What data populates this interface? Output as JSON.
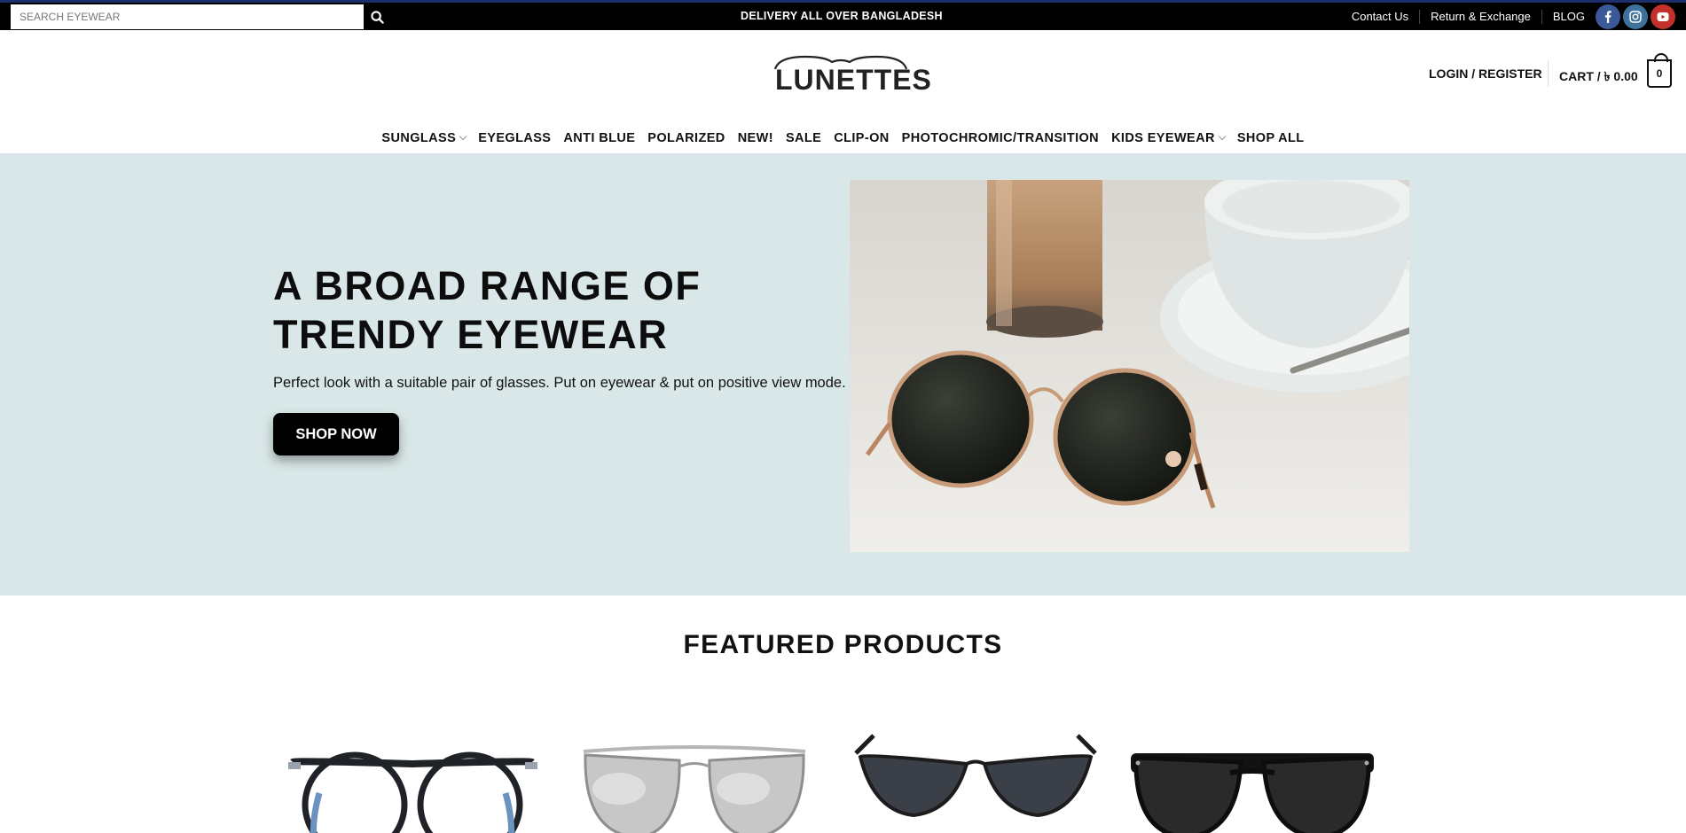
{
  "topbar": {
    "search_placeholder": "SEARCH EYEWEAR",
    "announcement": "DELIVERY ALL OVER BANGLADESH",
    "links": [
      "Contact Us",
      "Return & Exchange",
      "BLOG"
    ],
    "social": [
      {
        "name": "facebook-icon",
        "color": "#3b5998"
      },
      {
        "name": "instagram-icon",
        "color": "#3f729b"
      },
      {
        "name": "youtube-icon",
        "color": "#c4302b"
      }
    ]
  },
  "header": {
    "logo_text": "LUNETTES",
    "account_label": "LOGIN / REGISTER",
    "cart_label": "CART / ৳ 0.00",
    "cart_count": "0"
  },
  "nav": {
    "items": [
      {
        "label": "SUNGLASS",
        "has_dropdown": true
      },
      {
        "label": "EYEGLASS",
        "has_dropdown": false
      },
      {
        "label": "ANTI BLUE",
        "has_dropdown": false
      },
      {
        "label": "POLARIZED",
        "has_dropdown": false
      },
      {
        "label": "NEW!",
        "has_dropdown": false
      },
      {
        "label": "SALE",
        "has_dropdown": false
      },
      {
        "label": "CLIP-ON",
        "has_dropdown": false
      },
      {
        "label": "PHOTOCHROMIC/TRANSITION",
        "has_dropdown": false
      },
      {
        "label": "KIDS EYEWEAR",
        "has_dropdown": true
      },
      {
        "label": "SHOP ALL",
        "has_dropdown": false
      }
    ]
  },
  "hero": {
    "title_line1": "A BROAD RANGE OF",
    "title_line2": "TRENDY EYEWEAR",
    "subtitle": "Perfect look with a suitable pair of glasses. Put on eyewear & put on positive view mode.",
    "button_label": "SHOP NOW",
    "background": "#d9e7e8"
  },
  "featured": {
    "title": "FEATURED PRODUCTS"
  }
}
